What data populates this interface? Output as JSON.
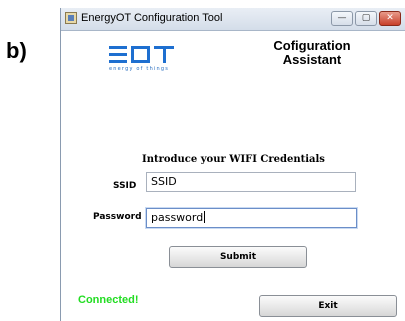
{
  "figure_label": "b)",
  "window": {
    "title": "EnergyOT Configuration Tool",
    "controls": {
      "minimize": "—",
      "maximize": "▢",
      "close": "✕"
    }
  },
  "logo": {
    "mark": "EOT",
    "tagline": "energy of things",
    "color": "#1e6fd0"
  },
  "heading": {
    "line1": "Cofiguration",
    "line2": "Assistant"
  },
  "form": {
    "intro": "Introduce your WIFI Credentials",
    "ssid": {
      "label": "SSID",
      "value": "SSID"
    },
    "password": {
      "label": "Password",
      "value": "password"
    },
    "submit_label": "Submit"
  },
  "status": {
    "text": "Connected!",
    "color": "#22dd22"
  },
  "exit_label": "Exit"
}
